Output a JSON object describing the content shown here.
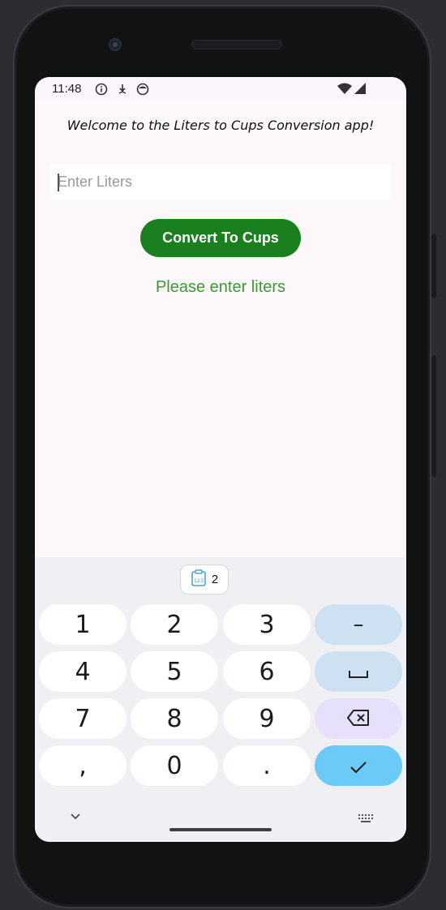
{
  "status_bar": {
    "time": "11:48",
    "icons": [
      "info-icon",
      "download-icon",
      "face-icon"
    ],
    "right_icons": [
      "wifi-icon",
      "signal-icon"
    ]
  },
  "app": {
    "welcome_text": "Welcome to the Liters to Cups Conversion app!",
    "liters_input": {
      "value": "",
      "placeholder": "Enter Liters"
    },
    "convert_button_label": "Convert To Cups",
    "result_text": "Please enter liters",
    "colors": {
      "button": "#1a7f1f",
      "result": "#3b9a33"
    }
  },
  "keyboard": {
    "clipboard_count": "2",
    "keys": {
      "k1": "1",
      "k2": "2",
      "k3": "3",
      "minus": "–",
      "k4": "4",
      "k5": "5",
      "k6": "6",
      "k7": "7",
      "k8": "8",
      "k9": "9",
      "comma": ",",
      "k0": "0",
      "period": "."
    },
    "special_icons": [
      "space-icon",
      "backspace-icon",
      "check-icon",
      "chevron-down-icon",
      "keyboard-icon"
    ]
  }
}
